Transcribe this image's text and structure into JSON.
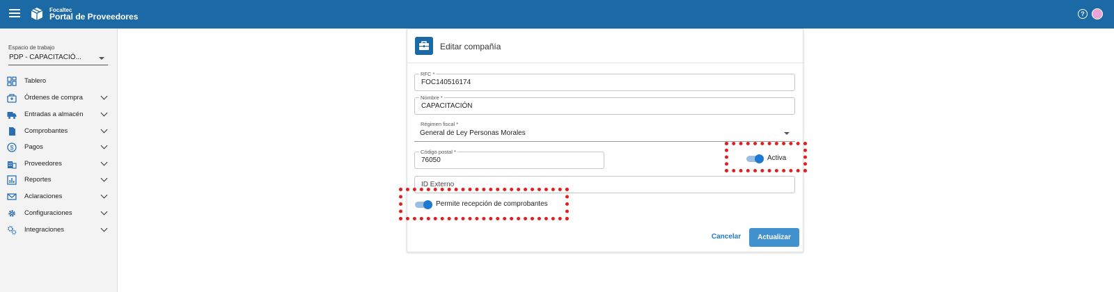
{
  "header": {
    "brand_small": "Focaltec",
    "brand_title": "Portal de Proveedores",
    "help_icon_label": "?"
  },
  "sidebar": {
    "workspace_label": "Espacio de trabajo",
    "workspace_value": "PDP - CAPACITACIÓ...",
    "items": [
      {
        "label": "Tablero",
        "icon": "dashboard-icon",
        "expandable": false
      },
      {
        "label": "Órdenes de compra",
        "icon": "purchase-orders-icon",
        "expandable": true
      },
      {
        "label": "Entradas a almacén",
        "icon": "truck-icon",
        "expandable": true
      },
      {
        "label": "Comprobantes",
        "icon": "document-icon",
        "expandable": true
      },
      {
        "label": "Pagos",
        "icon": "dollar-icon",
        "expandable": true
      },
      {
        "label": "Proveedores",
        "icon": "building-icon",
        "expandable": true
      },
      {
        "label": "Reportes",
        "icon": "report-icon",
        "expandable": true
      },
      {
        "label": "Aclaraciones",
        "icon": "mail-icon",
        "expandable": true
      },
      {
        "label": "Configuraciones",
        "icon": "gear-icon",
        "expandable": true
      },
      {
        "label": "Integraciones",
        "icon": "integrations-icon",
        "expandable": true
      }
    ]
  },
  "card": {
    "title": "Editar compañía",
    "fields": {
      "rfc": {
        "label": "RFC *",
        "value": "FOC140516174"
      },
      "nombre": {
        "label": "Nombre *",
        "value": "CAPACITACIÓN"
      },
      "regimen": {
        "label": "Régimen fiscal *",
        "value": "General de Ley Personas Morales"
      },
      "codigo_postal": {
        "label": "Código postal *",
        "value": "76050"
      },
      "id_externo": {
        "placeholder": "ID Externo"
      }
    },
    "toggles": {
      "activa": {
        "label": "Activa",
        "on": true
      },
      "permite": {
        "label": "Permite recepción de comprobantes",
        "on": true
      }
    },
    "actions": {
      "cancel_label": "Cancelar",
      "update_label": "Actualizar"
    }
  },
  "colors": {
    "header_bg": "#1b6aa5",
    "accent": "#1e7ad0",
    "highlight": "#e02020"
  }
}
